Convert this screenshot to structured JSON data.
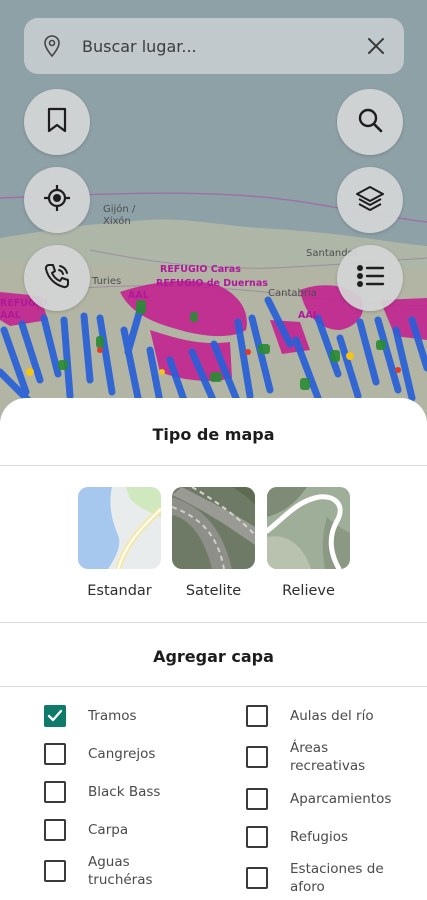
{
  "search": {
    "placeholder": "Buscar lugar..."
  },
  "map": {
    "place_labels": [
      "Gijón /",
      "Xixón",
      "Santander",
      "Turies",
      "Cantabria"
    ],
    "overlay_labels": [
      "REFUGIO Caras",
      "REFUGIO de Duernas",
      "AAL",
      "REFUGIO",
      "AAL",
      "AAL"
    ]
  },
  "buttons": {
    "saved": "bookmark-icon",
    "search": "search-icon",
    "location": "gps-target-icon",
    "layers": "layers-icon",
    "call": "phone-call-icon",
    "legend": "list-icon"
  },
  "sheet": {
    "map_type_title": "Tipo de mapa",
    "map_types": [
      {
        "label": "Estandar"
      },
      {
        "label": "Satelite"
      },
      {
        "label": "Relieve"
      }
    ],
    "layers_title": "Agregar capa",
    "layers_left": [
      {
        "label": "Tramos",
        "checked": true
      },
      {
        "label": "Cangrejos",
        "checked": false
      },
      {
        "label": "Black Bass",
        "checked": false
      },
      {
        "label": "Carpa",
        "checked": false
      },
      {
        "label": "Aguas truchéras",
        "checked": false
      }
    ],
    "layers_right": [
      {
        "label": "Aulas del río",
        "checked": false
      },
      {
        "label": "Áreas recreativas",
        "checked": false
      },
      {
        "label": "Aparcamientos",
        "checked": false
      },
      {
        "label": "Refugios",
        "checked": false
      },
      {
        "label": "Estaciones de aforo",
        "checked": false
      }
    ]
  },
  "colors": {
    "accent": "#0d7a6a",
    "fish_overlay": "#c2208f",
    "river_overlay": "#2860d8"
  }
}
